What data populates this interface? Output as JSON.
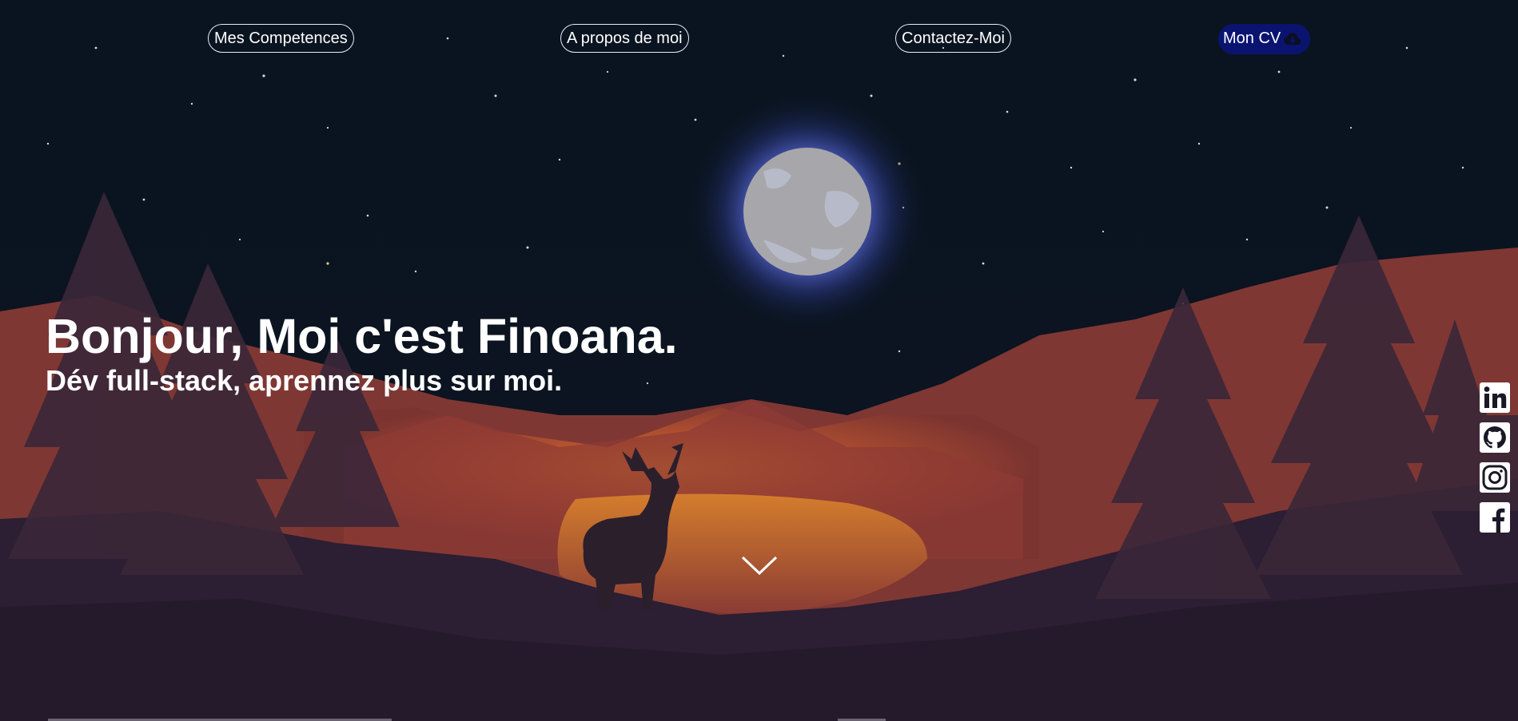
{
  "nav": {
    "skills_label": "Mes Competences",
    "about_label": "A propos de moi",
    "contact_label": "Contactez-Moi",
    "cv_label": "Mon CV",
    "cv_icon": "cloud-download-icon"
  },
  "hero": {
    "title": "Bonjour, Moi c'est Finoana.",
    "subtitle": "Dév full-stack, aprennez plus sur moi."
  },
  "scroll_icon": "chevron-down-icon",
  "socials": [
    "linkedin-icon",
    "github-icon",
    "instagram-icon",
    "facebook-icon"
  ],
  "colors": {
    "sky": "#0b1220",
    "moon": "#a9a9ad",
    "moon_glow": "#5c6fd0",
    "mountains": "#a14a33",
    "lake": "#c76d2c",
    "forest": "#2a1d33",
    "cv_button": "#0a1470"
  }
}
